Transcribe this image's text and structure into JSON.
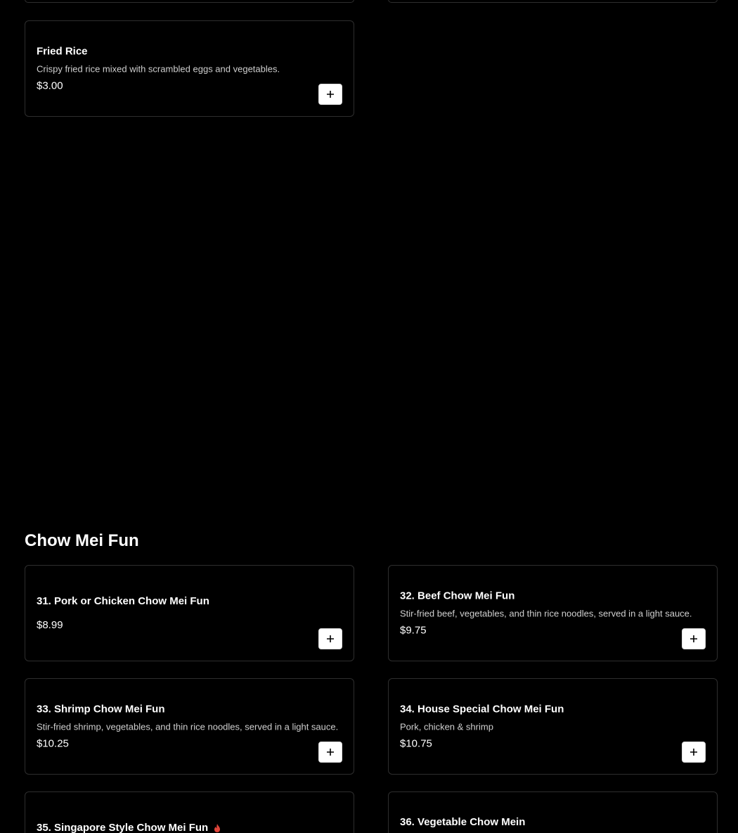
{
  "sections": [
    {
      "items": [
        {
          "name": "Fried Rice",
          "description": "Crispy fried rice mixed with scrambled eggs and vegetables.",
          "price": "$3.00"
        }
      ]
    },
    {
      "title": "Chow Mei Fun",
      "items": [
        {
          "name": "31. Pork or Chicken Chow Mei Fun",
          "price": "$8.99"
        },
        {
          "name": "32. Beef Chow Mei Fun",
          "description": "Stir-fried beef, vegetables, and thin rice noodles, served in a light sauce.",
          "price": "$9.75"
        },
        {
          "name": "33. Shrimp Chow Mei Fun",
          "description": "Stir-fried shrimp, vegetables, and thin rice noodles, served in a light sauce.",
          "price": "$10.25"
        },
        {
          "name": "34. House Special Chow Mei Fun",
          "description": "Pork, chicken & shrimp",
          "price": "$10.75"
        },
        {
          "name": "35. Singapore Style Chow Mei Fun",
          "spicy_icon": "fire-icon"
        },
        {
          "name": "36. Vegetable Chow Mein"
        }
      ]
    }
  ],
  "theme": {
    "background": "#000000",
    "card_border": "#2e2e2e",
    "add_button_bg": "#ffffff",
    "spicy_color": "#e0453a"
  }
}
